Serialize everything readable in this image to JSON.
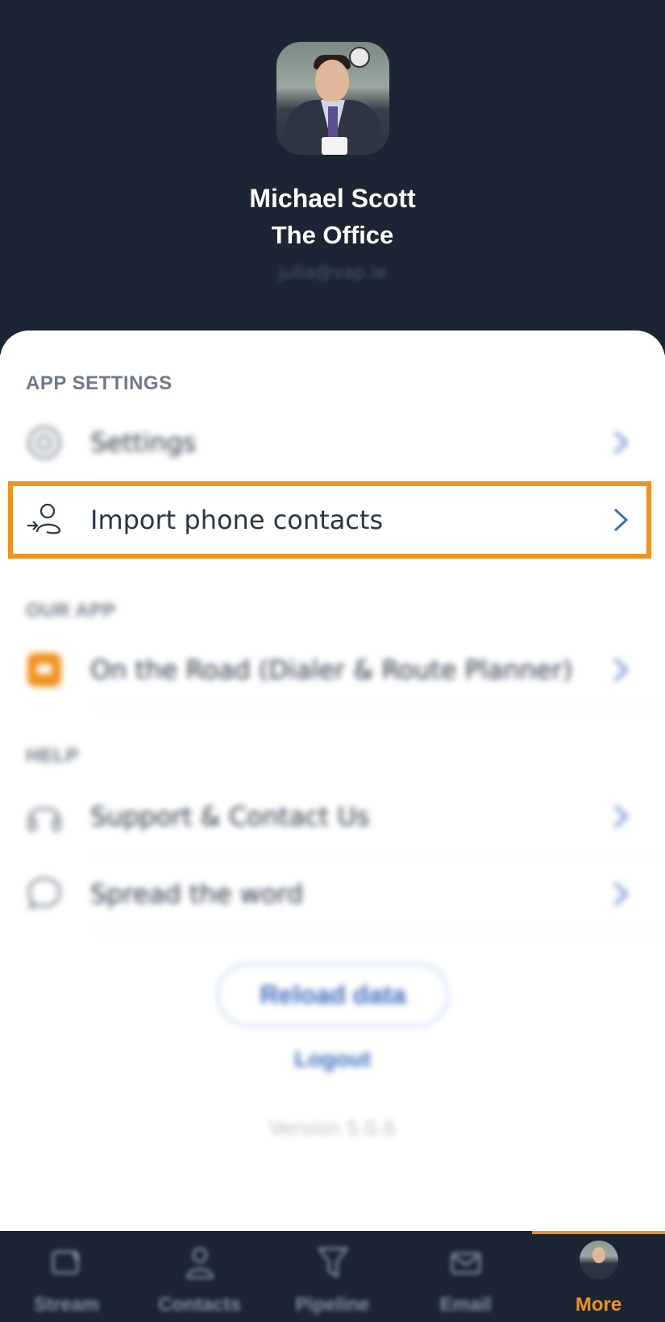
{
  "profile": {
    "name": "Michael Scott",
    "company": "The Office",
    "email": "julia@vap.ie"
  },
  "sections": {
    "app_settings": "APP SETTINGS",
    "our_app": "OUR APP",
    "help": "HELP"
  },
  "items": [
    {
      "label": "Settings",
      "icon": "gear-icon"
    },
    {
      "label": "Import phone contacts",
      "icon": "import-contacts-icon"
    },
    {
      "label": "On the Road (Dialer & Route Planner)",
      "icon": "on-the-road-app-icon"
    },
    {
      "label": "Support & Contact Us",
      "icon": "headset-icon"
    },
    {
      "label": "Spread the word",
      "icon": "chat-bubble-icon"
    }
  ],
  "actions": {
    "reload": "Reload data",
    "logout": "Logout",
    "version": "Version 5.0.6"
  },
  "tabs": [
    {
      "label": "Stream",
      "icon": "stream-icon"
    },
    {
      "label": "Contacts",
      "icon": "contact-person-icon"
    },
    {
      "label": "Pipeline",
      "icon": "pipeline-funnel-icon"
    },
    {
      "label": "Email",
      "icon": "email-icon"
    },
    {
      "label": "More",
      "icon": "avatar"
    }
  ],
  "colors": {
    "header_bg": "#1b2533",
    "accent": "#f0921e",
    "link": "#3f6dbd"
  }
}
